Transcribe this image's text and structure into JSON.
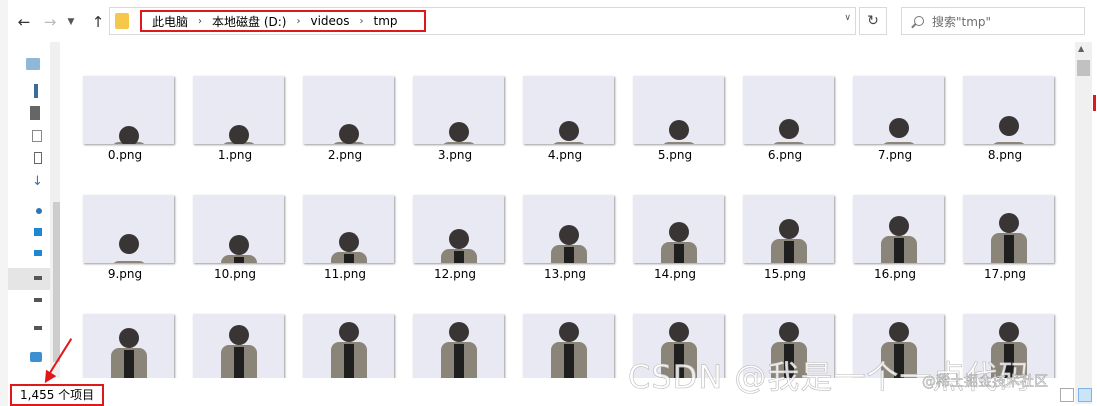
{
  "address": {
    "crumbs": [
      "此电脑",
      "本地磁盘 (D:)",
      "videos",
      "tmp"
    ]
  },
  "search": {
    "placeholder": "搜索\"tmp\""
  },
  "files": [
    "0.png",
    "1.png",
    "2.png",
    "3.png",
    "4.png",
    "5.png",
    "6.png",
    "7.png",
    "8.png",
    "9.png",
    "10.png",
    "11.png",
    "12.png",
    "13.png",
    "14.png",
    "15.png",
    "16.png",
    "17.png",
    "",
    "",
    "",
    "",
    "",
    "",
    "",
    "",
    ""
  ],
  "status": {
    "item_count": "1,455 个项目"
  },
  "watermark": {
    "text": "CSDN @我是一个一点代码",
    "sub": "@稀土掘金技术社区"
  },
  "colors": {
    "highlight": "#e0181a",
    "thumb_bg": "#e8e9f2"
  }
}
